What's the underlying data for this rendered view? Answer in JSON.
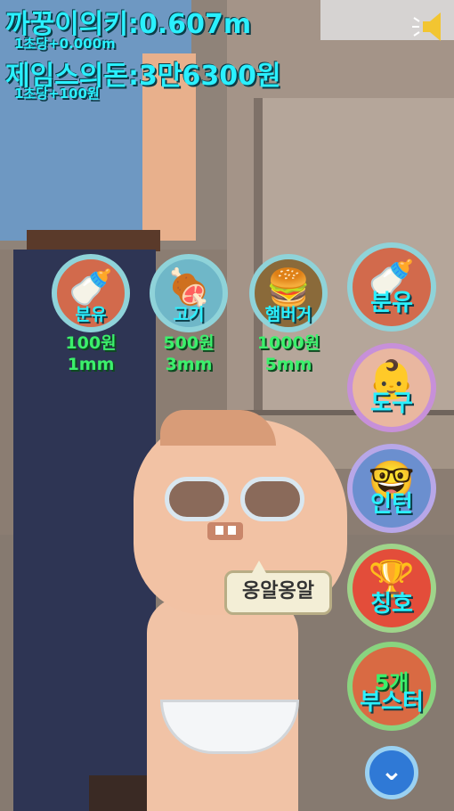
{
  "hud": {
    "height_line": "까꿍이의키:0.607m",
    "height_rate": "1초당+0.000m",
    "money_line": "제임스의돈:3만6300원",
    "money_rate": "1초당+100원"
  },
  "icons": {
    "sound": "speaker-icon",
    "down": "chevron-down-icon"
  },
  "foods": [
    {
      "name": "분유",
      "price": "100원",
      "growth": "1mm",
      "icon": "baby-bottle-icon"
    },
    {
      "name": "고기",
      "price": "500원",
      "growth": "3mm",
      "icon": "meat-icon"
    },
    {
      "name": "햄버거",
      "price": "1000원",
      "growth": "5mm",
      "icon": "burger-icon"
    }
  ],
  "menu": [
    {
      "label": "분유",
      "icon": "baby-bottle-icon",
      "color": "#d26a4c",
      "ring": "#8fd3d9"
    },
    {
      "label": "도구",
      "icon": "baby-face-icon",
      "color": "#e9b7a0",
      "ring": "#c790d9"
    },
    {
      "label": "인턴",
      "icon": "glasses-person-icon",
      "color": "#6b8fcf",
      "ring": "#b8a7e8"
    },
    {
      "label": "칭호",
      "icon": "trophy-icon",
      "color": "#e34d3a",
      "ring": "#9fd48a"
    },
    {
      "label_top": "5개",
      "label": "부스터",
      "icon": "rocket-icon",
      "color": "#d96a43",
      "ring": "#89d47f"
    }
  ],
  "speech": "옹알옹알"
}
